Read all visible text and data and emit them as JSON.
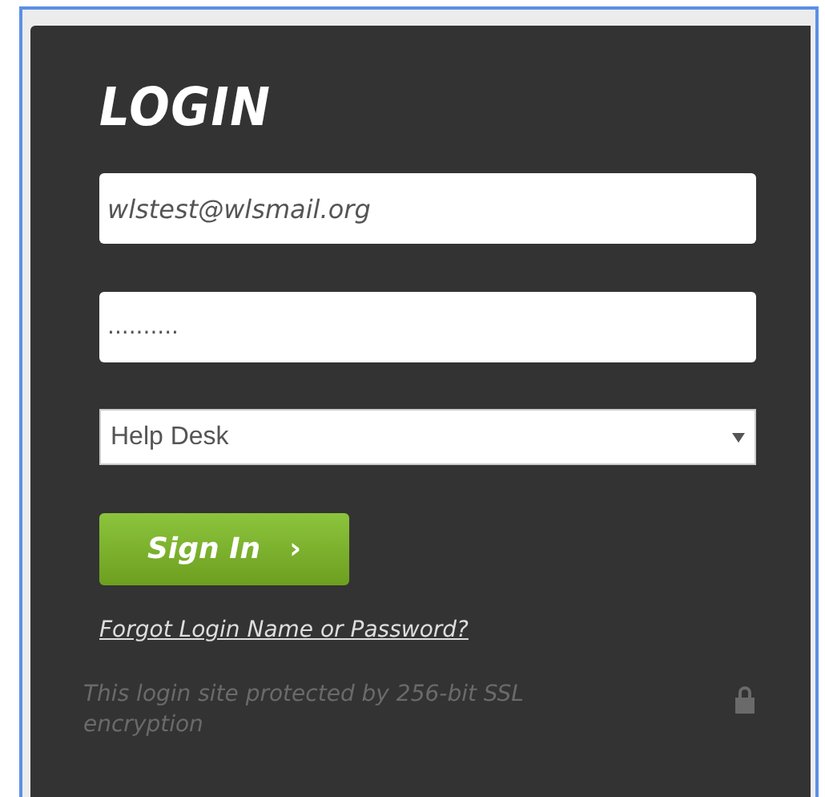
{
  "title": "LOGIN",
  "email": {
    "value": "wlstest@wlsmail.org"
  },
  "password": {
    "value": ".........."
  },
  "site_select": {
    "value": "Help Desk"
  },
  "sign_in_button": {
    "label": "Sign In",
    "arrow": "›"
  },
  "forgot_link": "Forgot Login Name or Password?",
  "security_note": "This login site protected by 256-bit SSL encryption"
}
